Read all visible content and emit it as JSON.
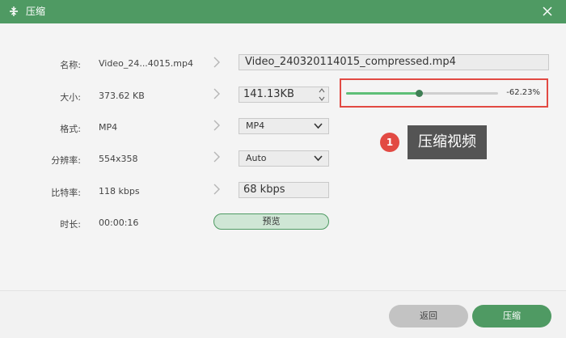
{
  "window": {
    "title": "压缩",
    "app_icon": "compress-icon",
    "close_icon": "close-icon"
  },
  "rows": {
    "name": {
      "label": "名称:",
      "original": "Video_24...4015.mp4",
      "output": "Video_240320114015_compressed.mp4"
    },
    "size": {
      "label": "大小:",
      "original": "373.62 KB",
      "output": "141.13KB",
      "compression_percent": "-62.23%",
      "slider_fraction": 0.48
    },
    "format": {
      "label": "格式:",
      "original": "MP4",
      "selected": "MP4"
    },
    "resolution": {
      "label": "分辨率:",
      "original": "554x358",
      "selected": "Auto"
    },
    "bitrate": {
      "label": "比特率:",
      "original": "118 kbps",
      "output": "68 kbps"
    },
    "duration": {
      "label": "时长:",
      "original": "00:00:16"
    }
  },
  "preview_button": "预览",
  "callout": {
    "number": "1",
    "text": "压缩视频"
  },
  "footer": {
    "back_label": "返回",
    "compress_label": "压缩"
  },
  "colors": {
    "brand": "#4f9a63",
    "highlight": "#e24a43",
    "slider_fill": "#5fbf78"
  }
}
